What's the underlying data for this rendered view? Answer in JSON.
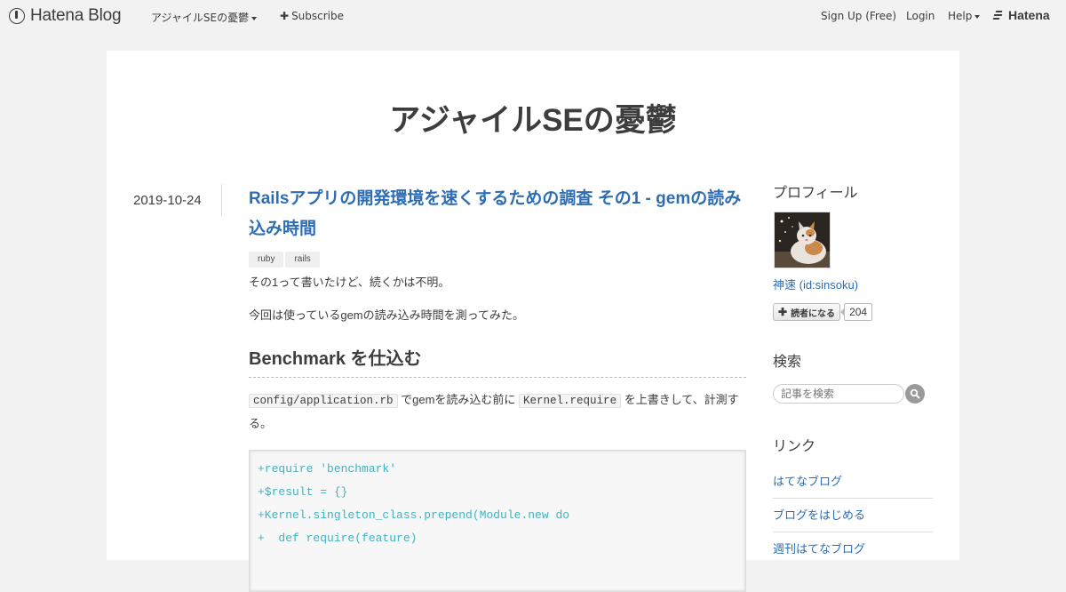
{
  "globalheader": {
    "logo_text": "Hatena Blog",
    "blog_menu_label": "アジャイルSEの憂鬱",
    "subscribe_label": "Subscribe",
    "signup_label": "Sign Up (Free)",
    "login_label": "Login",
    "help_label": "Help",
    "hatena_logo_text": "Hatena"
  },
  "blog": {
    "title": "アジャイルSEの憂鬱"
  },
  "entry": {
    "date": "2019-10-24",
    "title": "Railsアプリの開発環境を速くするための調査 その1 - gemの読み込み時間",
    "tags": [
      "ruby",
      "rails"
    ],
    "paragraph1": "その1って書いたけど、続くかは不明。",
    "paragraph2": "今回は使っているgemの読み込み時間を測ってみた。",
    "heading": "Benchmark を仕込む",
    "paragraph3": {
      "code1": "config/application.rb",
      "text1": " でgemを読み込む前に ",
      "code2": "Kernel.require",
      "text2": " を上書きして、計測する。"
    },
    "code_lines": [
      "+require 'benchmark'",
      "+$result = {}",
      "+Kernel.singleton_class.prepend(Module.new do",
      "+  def require(feature)"
    ]
  },
  "sidebar": {
    "profile_title": "プロフィール",
    "profile_name": "神速 (id:sinsoku)",
    "follow_label": "読者になる",
    "follow_count": "204",
    "search_title": "検索",
    "search_placeholder": "記事を検索",
    "links_title": "リンク",
    "links": [
      "はてなブログ",
      "ブログをはじめる",
      "週刊はてなブログ"
    ]
  },
  "colors": {
    "link": "#2d6db4",
    "code": "#42b2c2",
    "background": "#f2f2f2"
  }
}
